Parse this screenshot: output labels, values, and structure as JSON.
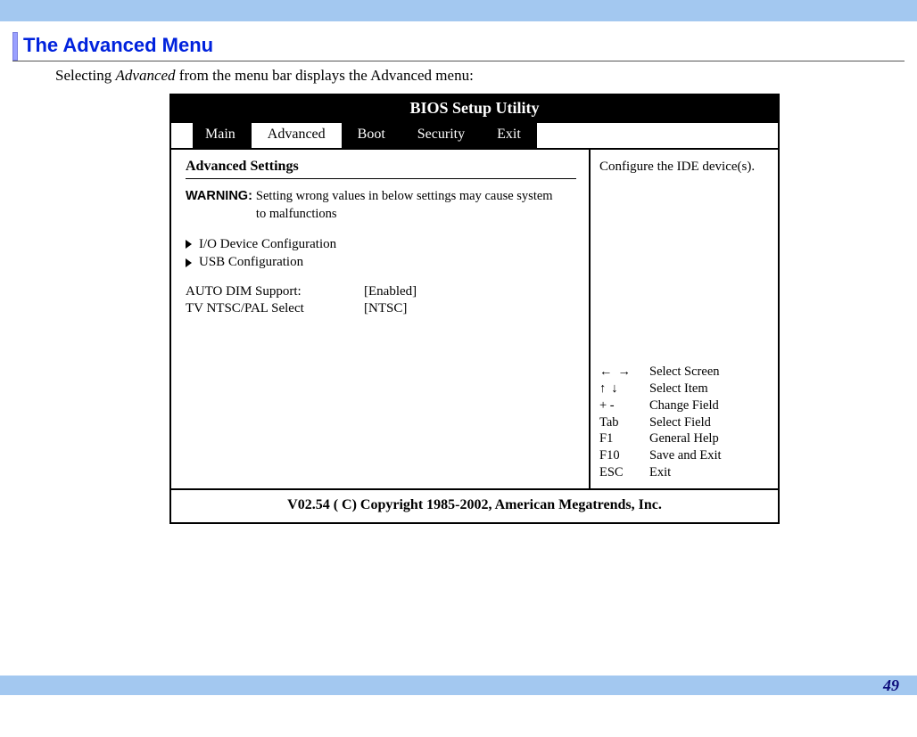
{
  "page": {
    "heading": "The Advanced Menu",
    "intro_pre": "Selecting ",
    "intro_ital": "Advanced",
    "intro_post": " from the menu bar displays the Advanced menu:",
    "number": "49"
  },
  "bios": {
    "title": "BIOS Setup Utility",
    "tabs": {
      "main": "Main",
      "advanced": "Advanced",
      "boot": "Boot",
      "security": "Security",
      "exit": "Exit"
    },
    "left": {
      "section_title": "Advanced Settings",
      "warning_label": "WARNING:",
      "warning_text": "Setting wrong values in below settings may cause system to malfunctions",
      "submenu1": "I/O Device Configuration",
      "submenu2": "USB Configuration",
      "kv1_label": "AUTO DIM Support:",
      "kv1_value": "[Enabled]",
      "kv2_label": "TV NTSC/PAL Select",
      "kv2_value": "[NTSC]"
    },
    "right": {
      "help": "Configure the IDE device(s).",
      "legend": {
        "k1": "← →",
        "v1": "Select Screen",
        "k2": "↑ ↓",
        "v2": "Select Item",
        "k3": "+ -",
        "v3": "Change Field",
        "k4": "Tab",
        "v4": "Select Field",
        "k5": "F1",
        "v5": "General Help",
        "k6": "F10",
        "v6": "Save and Exit",
        "k7": "ESC",
        "v7": "Exit"
      }
    },
    "footer": "V02.54  ( C) Copyright 1985-2002, American Megatrends, Inc."
  }
}
